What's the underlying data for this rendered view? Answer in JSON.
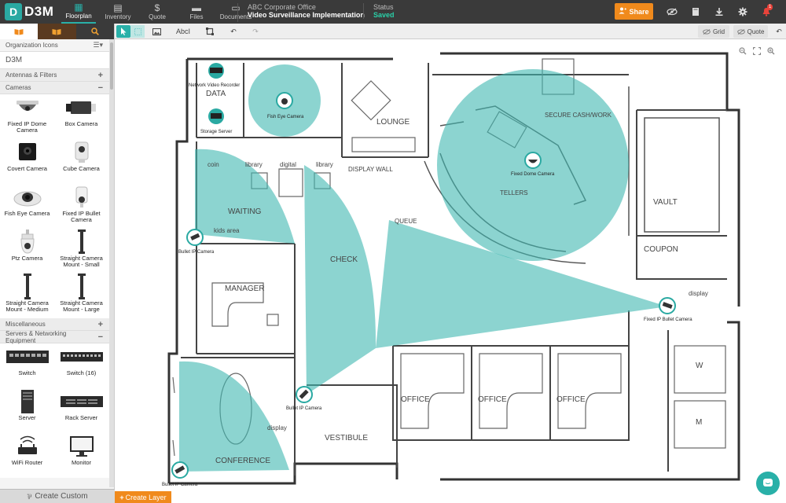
{
  "app": {
    "logo": "D3M",
    "logo_mark": "D"
  },
  "nav": [
    {
      "label": "Floorplan",
      "icon": "▦"
    },
    {
      "label": "Inventory",
      "icon": "▤"
    },
    {
      "label": "Quote",
      "icon": "$"
    },
    {
      "label": "Files",
      "icon": "▬"
    },
    {
      "label": "Documents",
      "icon": "▭"
    }
  ],
  "project": {
    "org": "ABC Corporate Office",
    "name": "Video Surveillance Implementation"
  },
  "status": {
    "label": "Status",
    "value": "Saved"
  },
  "share_label": "Share",
  "notifications": {
    "count": "1"
  },
  "panel": {
    "org_icons": "Organization Icons",
    "d3m": "D3M",
    "antennas": "Antennas & Filters",
    "cameras": "Cameras",
    "misc": "Miscellaneous",
    "servers": "Servers & Networking Equipment",
    "create_custom": "Create Custom",
    "camera_items": [
      "Fixed IP Dome Camera",
      "Box Camera",
      "Covert Camera",
      "Cube Camera",
      "Fish Eye Camera",
      "Fixed IP Bullet Camera",
      "Ptz Camera",
      "Straight Camera Mount - Small",
      "Straight Camera Mount - Medium",
      "Straight Camera Mount - Large"
    ],
    "server_items": [
      "Switch",
      "Switch (16)",
      "Server",
      "Rack Server",
      "WiFi Router",
      "Monitor"
    ]
  },
  "toolbar": {
    "text_tool": "AbcI",
    "grid": "Grid",
    "quote": "Quote"
  },
  "create_layer": "Create Layer",
  "floorplan": {
    "rooms": [
      "DATA",
      "LOUNGE",
      "SECURE CASH/WORK",
      "WAITING",
      "DISPLAY WALL",
      "TELLERS",
      "VAULT",
      "COUPON",
      "MANAGER",
      "CHECK",
      "QUEUE",
      "CONFERENCE",
      "VESTIBULE",
      "OFFICE",
      "OFFICE",
      "OFFICE",
      "W",
      "M"
    ],
    "small_labels": [
      "coin",
      "library",
      "digital",
      "library",
      "kids area",
      "display",
      "display"
    ],
    "devices": [
      "Network Video Recorder",
      "Storage Server",
      "Fish Eye Camera",
      "Fixed Dome Camera",
      "Bullet IP Camera",
      "Fixed IP Bullet Camera",
      "Bullet IP Camera",
      "Bullet IP Camera"
    ]
  },
  "colors": {
    "accent": "#29b0a8",
    "coverage": "#3fb8b0",
    "orange": "#f08a1c",
    "topbar": "#3a3a3a"
  }
}
